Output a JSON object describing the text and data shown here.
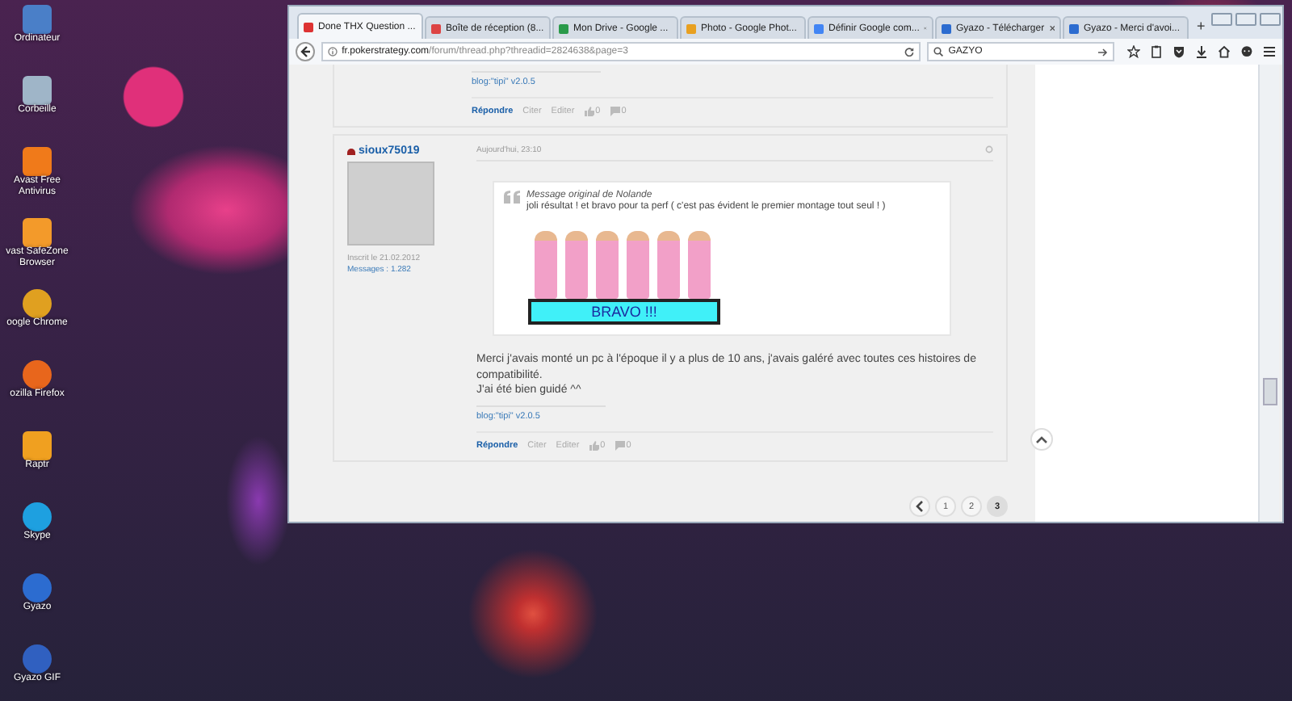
{
  "desktop_icons": [
    {
      "label": "Ordinateur",
      "kind": "computer"
    },
    {
      "label": "Corbeille",
      "kind": "trash"
    },
    {
      "label": "Avast Free Antivirus",
      "kind": "avast"
    },
    {
      "label": "vast SafeZone Browser",
      "kind": "safezone"
    },
    {
      "label": "oogle Chrome",
      "kind": "chrome"
    },
    {
      "label": "ozilla Firefox",
      "kind": "firefox"
    },
    {
      "label": "Raptr",
      "kind": "raptr"
    },
    {
      "label": "Skype",
      "kind": "skype"
    },
    {
      "label": "Gyazo",
      "kind": "gyazo"
    },
    {
      "label": "Gyazo GIF",
      "kind": "gyazogif"
    }
  ],
  "browser": {
    "tabs": [
      {
        "title": "Done THX Question ...",
        "kind": "forum",
        "selected": true
      },
      {
        "title": "Boîte de réception (8...",
        "kind": "mail",
        "selected": false
      },
      {
        "title": "Mon Drive - Google ...",
        "kind": "drive",
        "selected": false
      },
      {
        "title": "Photo - Google Phot...",
        "kind": "photos",
        "selected": false
      },
      {
        "title": "Définir Google com...",
        "kind": "google",
        "selected": false
      },
      {
        "title": "Gyazo - Télécharger",
        "kind": "gyazo",
        "selected": false
      },
      {
        "title": "Gyazo - Merci d'avoi...",
        "kind": "gyazo",
        "selected": false
      }
    ],
    "new_tab": "+",
    "url_host": "fr.pokerstrategy.com",
    "url_path": "/forum/thread.php?threadid=2824638&page=3",
    "search": {
      "value": "GAZYO"
    }
  },
  "posts": [
    {
      "kind": "tail",
      "signature": "blog:\"tipi\" v2.0.5",
      "actions": {
        "reply": "Répondre",
        "quote": "Citer",
        "edit": "Editer",
        "likes": "0",
        "comments": "0"
      }
    },
    {
      "kind": "full",
      "username": "sioux75019",
      "registered": "Inscrit le 21.02.2012",
      "messages": "Messages : 1.282",
      "date": "Aujourd'hui, 23:10",
      "quote": {
        "source": "Message original de Nolande",
        "text": "joli résultat ! et bravo pour ta perf ( c'est pas évident le premier montage tout seul ! )",
        "image_text": "BRAVO !!!"
      },
      "body": [
        "Merci j'avais monté un pc à l'époque il y a plus de 10 ans, j'avais galéré avec toutes ces histoires de compatibilité.",
        "J'ai été bien guidé ^^"
      ],
      "signature": "blog:\"tipi\" v2.0.5",
      "actions": {
        "reply": "Répondre",
        "quote": "Citer",
        "edit": "Editer",
        "likes": "0",
        "comments": "0"
      }
    }
  ],
  "pagination": {
    "pages": [
      {
        "label": "1",
        "selected": false
      },
      {
        "label": "2",
        "selected": false
      },
      {
        "label": "3",
        "selected": true
      }
    ]
  }
}
